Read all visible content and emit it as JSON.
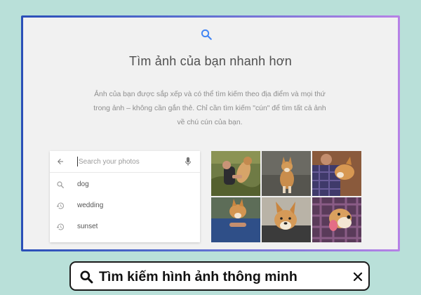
{
  "card": {
    "heading": "Tìm ảnh của bạn nhanh hơn",
    "description": "Ảnh của bạn được sắp xếp và có thể tìm kiếm theo địa điểm và mọi thứ trong ảnh – không cần gắn thẻ. Chỉ cần tìm kiếm \"cún\" để tìm tất cả ảnh về chú cún của bạn."
  },
  "search": {
    "placeholder": "Search your photos",
    "value": "",
    "suggestions": [
      {
        "label": "dog",
        "icon": "search-icon"
      },
      {
        "label": "wedding",
        "icon": "history-icon"
      },
      {
        "label": "sunset",
        "icon": "history-icon"
      }
    ]
  },
  "photos": [
    {
      "name": "photo-dog-1"
    },
    {
      "name": "photo-dog-2"
    },
    {
      "name": "photo-dog-3"
    },
    {
      "name": "photo-dog-4"
    },
    {
      "name": "photo-dog-5"
    },
    {
      "name": "photo-dog-6"
    }
  ],
  "banner": {
    "title": "Tìm kiếm hình ảnh thông minh"
  },
  "colors": {
    "page_background": "#b9e0d9",
    "card_background": "#f1f1f1",
    "accent_blue": "#4285f4",
    "frame_gradient_start": "#2a4fb8",
    "frame_gradient_end": "#b782e6"
  }
}
